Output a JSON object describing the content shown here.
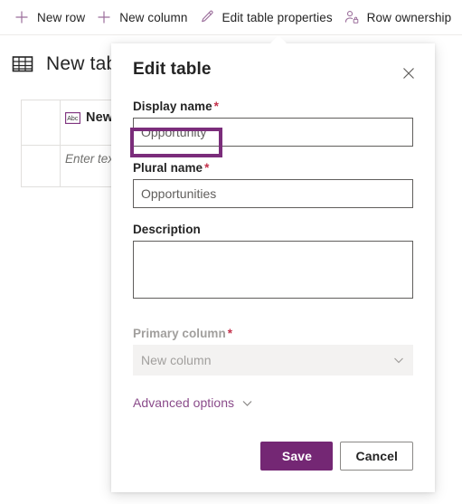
{
  "commandbar": {
    "items": [
      {
        "label": "New row",
        "icon": "plus-icon"
      },
      {
        "label": "New column",
        "icon": "plus-icon"
      },
      {
        "label": "Edit table properties",
        "icon": "pencil-icon"
      },
      {
        "label": "Row ownership",
        "icon": "person-lock-icon"
      }
    ]
  },
  "page": {
    "title": "New table",
    "table_icon": "table-icon",
    "grid": {
      "header_icon": "abc-text-icon",
      "header_label": "New column",
      "cell_placeholder": "Enter text value"
    }
  },
  "dialog": {
    "title": "Edit table",
    "close_icon": "close-icon",
    "fields": {
      "display_name": {
        "label": "Display name",
        "required_marker": "*",
        "value": "Opportunity",
        "placeholder": ""
      },
      "plural_name": {
        "label": "Plural name",
        "required_marker": "*",
        "value": "Opportunities",
        "placeholder": ""
      },
      "description": {
        "label": "Description",
        "value": "",
        "placeholder": ""
      },
      "primary_column": {
        "label": "Primary column",
        "required_marker": "*",
        "value": "New column",
        "caret_icon": "chevron-down-icon",
        "disabled": true
      }
    },
    "advanced_options": {
      "label": "Advanced options",
      "caret_icon": "chevron-down-icon"
    },
    "buttons": {
      "save": "Save",
      "cancel": "Cancel"
    }
  },
  "colors": {
    "brand_purple": "#742774",
    "icon_purple": "#9b6e9b",
    "link_purple": "#8a4b8a",
    "required_red": "#c4314b",
    "annotation_purple": "#7b2d7b",
    "text_primary": "#242424",
    "text_disabled": "#a19f9d"
  }
}
